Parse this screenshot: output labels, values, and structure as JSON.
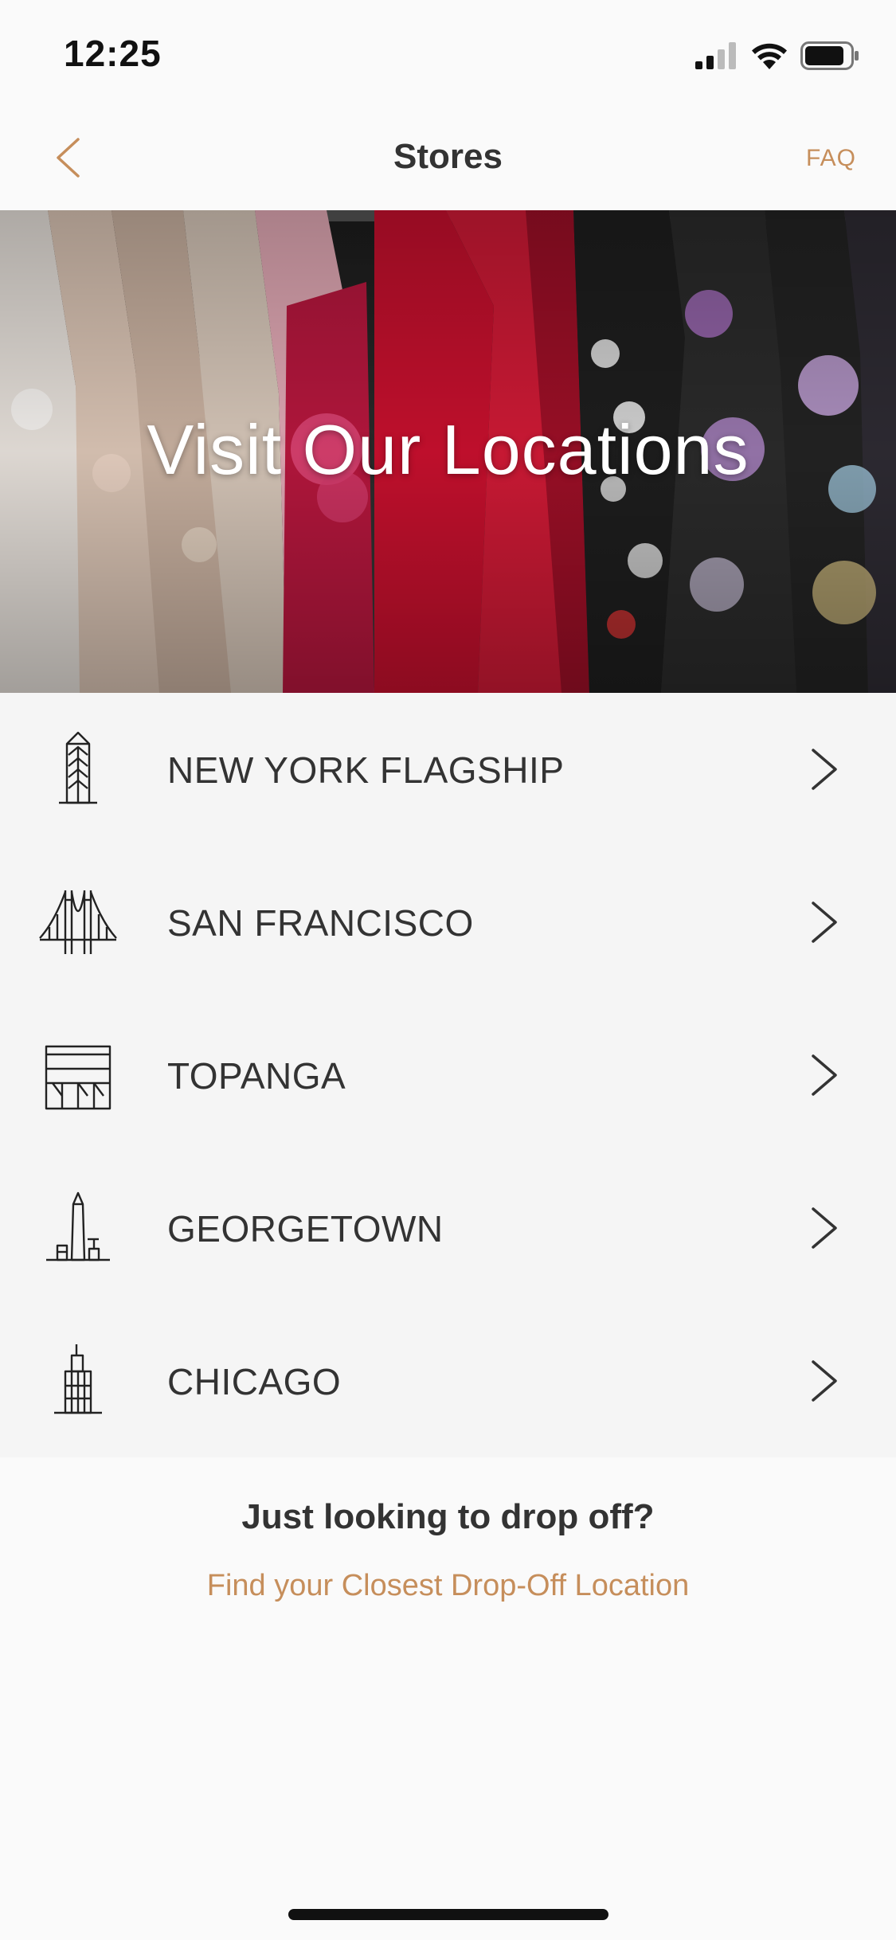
{
  "status_bar": {
    "time": "12:25",
    "icons": [
      "cellular-signal-icon",
      "wifi-icon",
      "battery-icon"
    ]
  },
  "nav": {
    "back_icon": "chevron-left-icon",
    "title": "Stores",
    "faq_label": "FAQ"
  },
  "hero": {
    "title": "Visit Our Locations"
  },
  "stores": [
    {
      "label": "NEW YORK FLAGSHIP",
      "icon": "flatiron-building-icon"
    },
    {
      "label": "SAN FRANCISCO",
      "icon": "golden-gate-bridge-icon"
    },
    {
      "label": "TOPANGA",
      "icon": "storefront-icon"
    },
    {
      "label": "GEORGETOWN",
      "icon": "washington-monument-icon"
    },
    {
      "label": "CHICAGO",
      "icon": "skyscraper-icon"
    }
  ],
  "dropoff": {
    "title": "Just looking to drop off?",
    "link_label": "Find your Closest Drop-Off Location"
  },
  "colors": {
    "accent": "#c68e5b",
    "text": "#333333",
    "list_background": "#f5f5f5",
    "page_background": "#fafafa"
  }
}
